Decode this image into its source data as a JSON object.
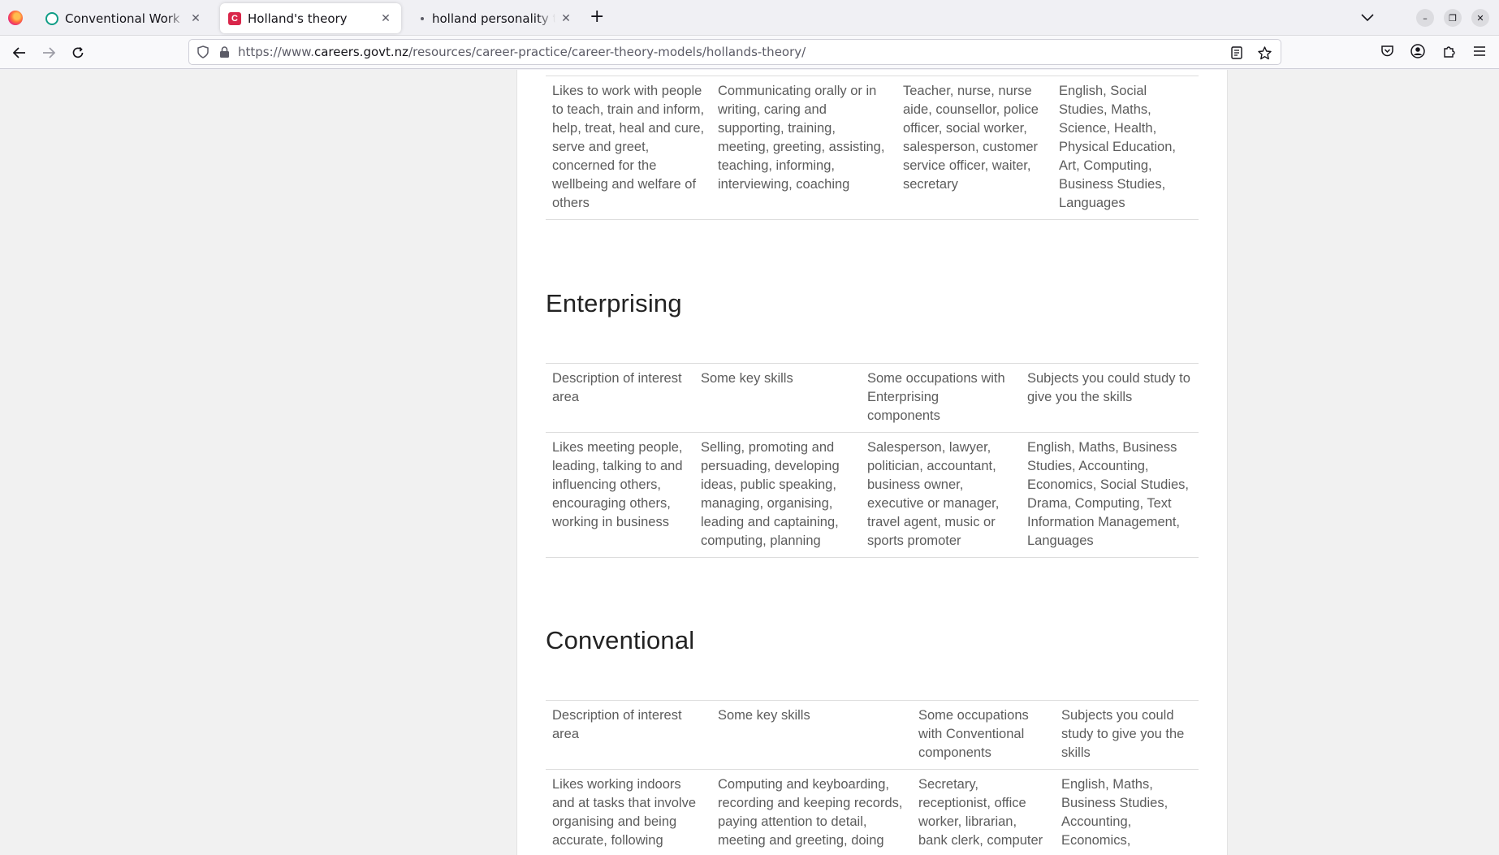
{
  "browser": {
    "tabs": [
      {
        "title": "Conventional Work Personality",
        "active": false,
        "favicon": "chatgpt-icon"
      },
      {
        "title": "Holland's theory",
        "active": true,
        "favicon": "careers-nz-icon"
      },
      {
        "title": "holland personality types",
        "active": false,
        "favicon": "loading-dot-icon"
      }
    ],
    "url_prefix": "https://www.",
    "url_domain": "careers.govt.nz",
    "url_path": "/resources/career-practice/career-theory-models/hollands-theory/"
  },
  "page": {
    "social_table": {
      "rows": [
        [
          "Likes to work with people to teach, train and inform, help, treat, heal and cure, serve and greet, concerned for the wellbeing and welfare of others",
          "Communicating orally or in writing, caring and supporting, training, meeting, greeting, assisting, teaching, informing, interviewing, coaching",
          "Teacher, nurse, nurse aide, counsellor, police officer, social worker, salesperson, customer service officer, waiter, secretary",
          "English, Social Studies, Maths, Science, Health, Physical Education, Art, Computing, Business Studies, Languages"
        ]
      ]
    },
    "enterprising": {
      "heading": "Enterprising",
      "headers": [
        "Description of interest area",
        "Some key skills",
        "Some occupations with Enterprising components",
        "Subjects you could study to give you the skills"
      ],
      "rows": [
        [
          "Likes meeting people, leading, talking to and influencing others, encouraging others, working in business",
          "Selling, promoting and persuading, developing ideas, public speaking, managing, organising, leading and captaining, computing, planning",
          "Salesperson, lawyer, politician, accountant, business owner, executive or manager, travel agent, music or sports promoter",
          "English, Maths, Business Studies, Accounting, Economics, Social Studies, Drama, Computing, Text Information Management, Languages"
        ]
      ]
    },
    "conventional": {
      "heading": "Conventional",
      "headers": [
        "Description of interest area",
        "Some key skills",
        "Some occupations with Conventional components",
        "Subjects you could study to give you the skills"
      ],
      "rows": [
        [
          "Likes working indoors and at tasks that involve organising and being accurate, following",
          "Computing and keyboarding, recording and keeping records, paying attention to detail, meeting and greeting, doing",
          "Secretary, receptionist, office worker, librarian, bank clerk, computer",
          "English, Maths, Business Studies, Accounting, Economics,"
        ]
      ]
    }
  }
}
